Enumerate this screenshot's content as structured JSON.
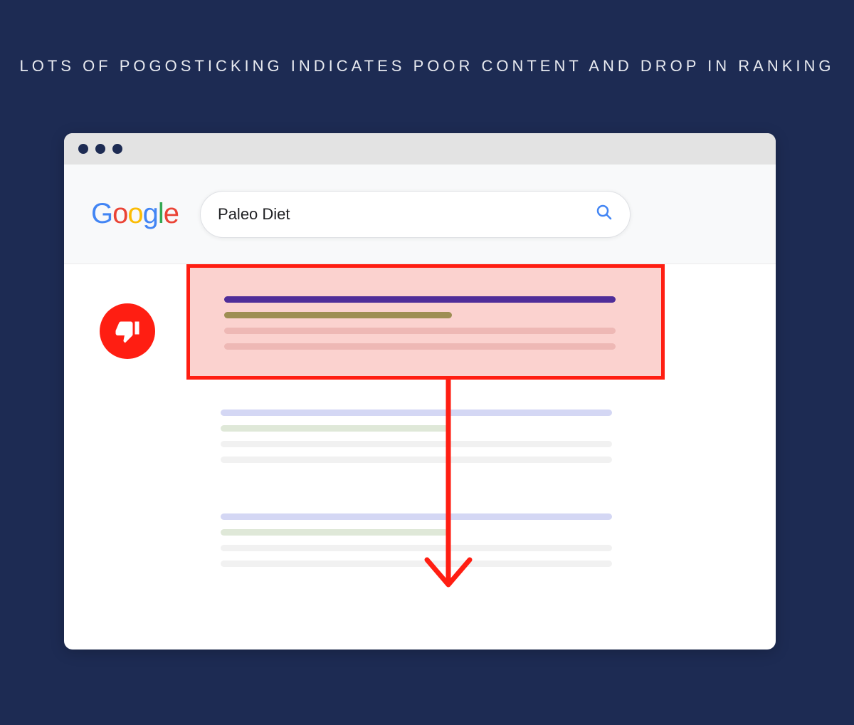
{
  "title": "LOTS OF POGOSTICKING INDICATES POOR CONTENT AND DROP IN RANKING",
  "search": {
    "logo_g1": "G",
    "logo_o1": "o",
    "logo_o2": "o",
    "logo_g2": "g",
    "logo_l": "l",
    "logo_e": "e",
    "query": "Paleo Diet"
  },
  "icons": {
    "thumbs_down": "thumbs-down-icon",
    "search": "search-icon",
    "arrow_down": "arrow-down-icon"
  },
  "colors": {
    "background": "#1d2b53",
    "highlight_border": "#ff1e12",
    "highlight_fill": "#fbd2cf"
  }
}
